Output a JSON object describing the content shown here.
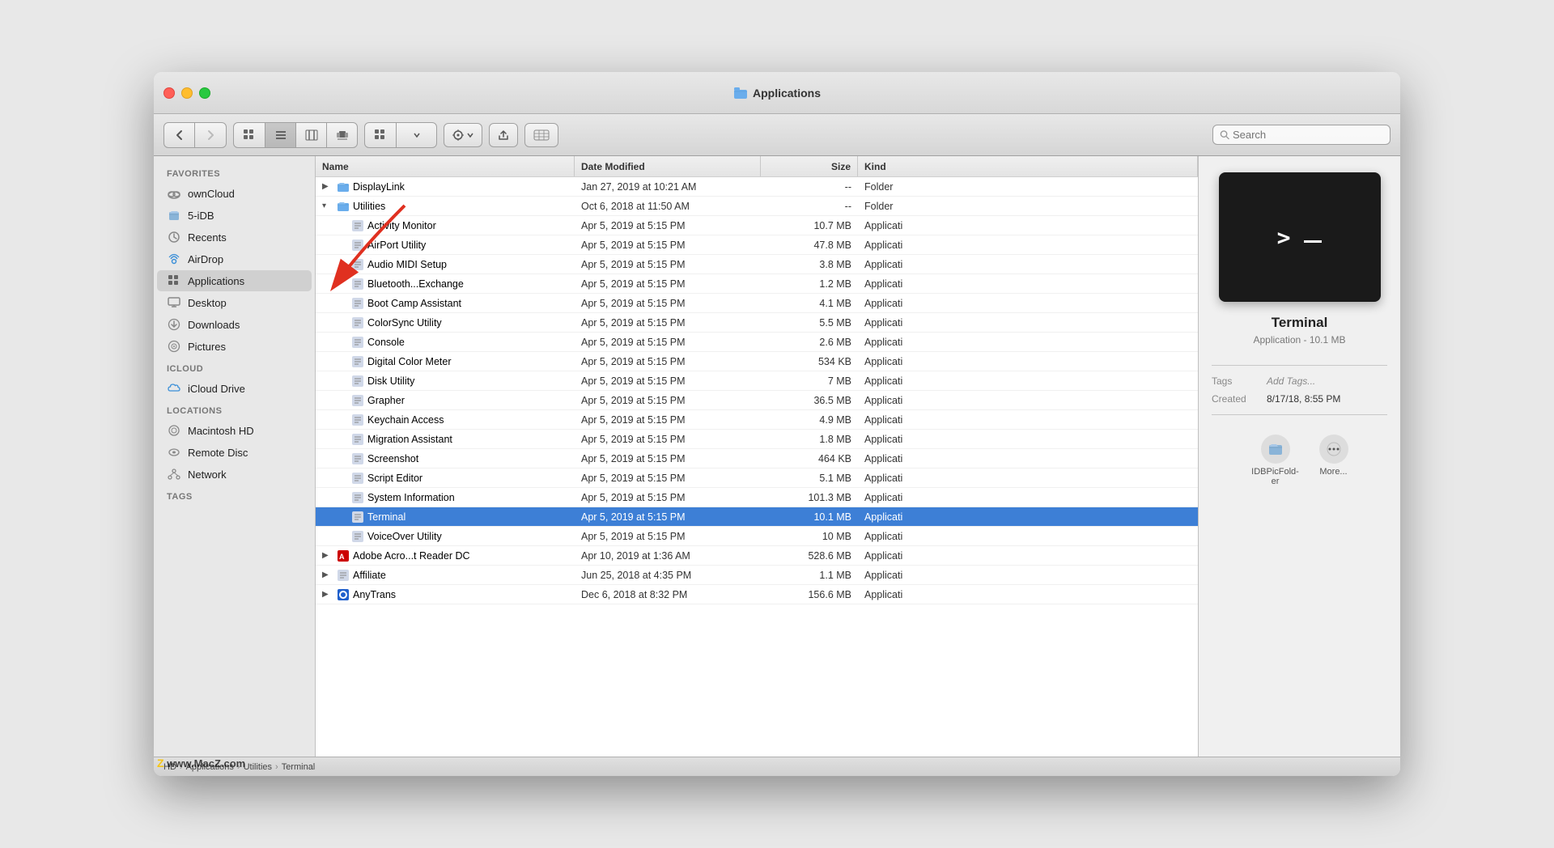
{
  "window": {
    "title": "Applications",
    "traffic_lights": [
      "close",
      "minimize",
      "maximize"
    ]
  },
  "toolbar": {
    "back_label": "‹",
    "forward_label": "›",
    "view_icon": "⊞",
    "view_list": "≡",
    "view_column": "⊟",
    "view_coverflow": "⊡",
    "view_group": "⊞",
    "action_label": "⚙",
    "share_label": "↑",
    "tag_label": "⬜",
    "search_placeholder": "Search"
  },
  "sidebar": {
    "favorites_label": "Favorites",
    "icloud_label": "iCloud",
    "locations_label": "Locations",
    "tags_label": "Tags",
    "items": [
      {
        "id": "owncloud",
        "label": "ownCloud",
        "icon": "cloud"
      },
      {
        "id": "5idb",
        "label": "5-iDB",
        "icon": "folder"
      },
      {
        "id": "recents",
        "label": "Recents",
        "icon": "clock"
      },
      {
        "id": "airdrop",
        "label": "AirDrop",
        "icon": "airdrop"
      },
      {
        "id": "applications",
        "label": "Applications",
        "icon": "grid",
        "active": true
      },
      {
        "id": "desktop",
        "label": "Desktop",
        "icon": "desktop"
      },
      {
        "id": "downloads",
        "label": "Downloads",
        "icon": "download"
      },
      {
        "id": "pictures",
        "label": "Pictures",
        "icon": "photo"
      },
      {
        "id": "icloud-drive",
        "label": "iCloud Drive",
        "icon": "icloud"
      },
      {
        "id": "macintosh-hd",
        "label": "Macintosh HD",
        "icon": "disk"
      },
      {
        "id": "remote-disc",
        "label": "Remote Disc",
        "icon": "disc"
      },
      {
        "id": "network",
        "label": "Network",
        "icon": "network"
      }
    ]
  },
  "columns": {
    "name": "Name",
    "date_modified": "Date Modified",
    "size": "Size",
    "kind": "Kind"
  },
  "files": [
    {
      "id": 1,
      "name": "DisplayLink",
      "date": "Jan 27, 2019 at 10:21 AM",
      "size": "--",
      "kind": "Folder",
      "indent": 0,
      "expanded": false,
      "type": "folder"
    },
    {
      "id": 2,
      "name": "Utilities",
      "date": "Oct 6, 2018 at 11:50 AM",
      "size": "--",
      "kind": "Folder",
      "indent": 0,
      "expanded": true,
      "type": "folder"
    },
    {
      "id": 3,
      "name": "Activity Monitor",
      "date": "Apr 5, 2019 at 5:15 PM",
      "size": "10.7 MB",
      "kind": "Applicati",
      "indent": 1,
      "type": "app"
    },
    {
      "id": 4,
      "name": "AirPort Utility",
      "date": "Apr 5, 2019 at 5:15 PM",
      "size": "47.8 MB",
      "kind": "Applicati",
      "indent": 1,
      "type": "app"
    },
    {
      "id": 5,
      "name": "Audio MIDI Setup",
      "date": "Apr 5, 2019 at 5:15 PM",
      "size": "3.8 MB",
      "kind": "Applicati",
      "indent": 1,
      "type": "app"
    },
    {
      "id": 6,
      "name": "Bluetooth...Exchange",
      "date": "Apr 5, 2019 at 5:15 PM",
      "size": "1.2 MB",
      "kind": "Applicati",
      "indent": 1,
      "type": "app"
    },
    {
      "id": 7,
      "name": "Boot Camp Assistant",
      "date": "Apr 5, 2019 at 5:15 PM",
      "size": "4.1 MB",
      "kind": "Applicati",
      "indent": 1,
      "type": "app"
    },
    {
      "id": 8,
      "name": "ColorSync Utility",
      "date": "Apr 5, 2019 at 5:15 PM",
      "size": "5.5 MB",
      "kind": "Applicati",
      "indent": 1,
      "type": "app"
    },
    {
      "id": 9,
      "name": "Console",
      "date": "Apr 5, 2019 at 5:15 PM",
      "size": "2.6 MB",
      "kind": "Applicati",
      "indent": 1,
      "type": "app"
    },
    {
      "id": 10,
      "name": "Digital Color Meter",
      "date": "Apr 5, 2019 at 5:15 PM",
      "size": "534 KB",
      "kind": "Applicati",
      "indent": 1,
      "type": "app"
    },
    {
      "id": 11,
      "name": "Disk Utility",
      "date": "Apr 5, 2019 at 5:15 PM",
      "size": "7 MB",
      "kind": "Applicati",
      "indent": 1,
      "type": "app"
    },
    {
      "id": 12,
      "name": "Grapher",
      "date": "Apr 5, 2019 at 5:15 PM",
      "size": "36.5 MB",
      "kind": "Applicati",
      "indent": 1,
      "type": "app"
    },
    {
      "id": 13,
      "name": "Keychain Access",
      "date": "Apr 5, 2019 at 5:15 PM",
      "size": "4.9 MB",
      "kind": "Applicati",
      "indent": 1,
      "type": "app"
    },
    {
      "id": 14,
      "name": "Migration Assistant",
      "date": "Apr 5, 2019 at 5:15 PM",
      "size": "1.8 MB",
      "kind": "Applicati",
      "indent": 1,
      "type": "app"
    },
    {
      "id": 15,
      "name": "Screenshot",
      "date": "Apr 5, 2019 at 5:15 PM",
      "size": "464 KB",
      "kind": "Applicati",
      "indent": 1,
      "type": "app"
    },
    {
      "id": 16,
      "name": "Script Editor",
      "date": "Apr 5, 2019 at 5:15 PM",
      "size": "5.1 MB",
      "kind": "Applicati",
      "indent": 1,
      "type": "app"
    },
    {
      "id": 17,
      "name": "System Information",
      "date": "Apr 5, 2019 at 5:15 PM",
      "size": "101.3 MB",
      "kind": "Applicati",
      "indent": 1,
      "type": "app"
    },
    {
      "id": 18,
      "name": "Terminal",
      "date": "Apr 5, 2019 at 5:15 PM",
      "size": "10.1 MB",
      "kind": "Applicati",
      "indent": 1,
      "type": "app",
      "selected": true
    },
    {
      "id": 19,
      "name": "VoiceOver Utility",
      "date": "Apr 5, 2019 at 5:15 PM",
      "size": "10 MB",
      "kind": "Applicati",
      "indent": 1,
      "type": "app"
    },
    {
      "id": 20,
      "name": "Adobe Acro...t Reader DC",
      "date": "Apr 10, 2019 at 1:36 AM",
      "size": "528.6 MB",
      "kind": "Applicati",
      "indent": 0,
      "type": "app-adobe"
    },
    {
      "id": 21,
      "name": "Affiliate",
      "date": "Jun 25, 2018 at 4:35 PM",
      "size": "1.1 MB",
      "kind": "Applicati",
      "indent": 0,
      "type": "app"
    },
    {
      "id": 22,
      "name": "AnyTrans",
      "date": "Dec 6, 2018 at 8:32 PM",
      "size": "156.6 MB",
      "kind": "Applicati",
      "indent": 0,
      "type": "app-blue"
    }
  ],
  "preview": {
    "app_name": "Terminal",
    "app_type": "Application - 10.1 MB",
    "tags_label": "Tags",
    "tags_action": "Add Tags...",
    "created_label": "Created",
    "created_value": "8/17/18, 8:55 PM",
    "action1_label": "IDBPicFold-\ner",
    "action2_label": "More...",
    "terminal_prompt": "> _"
  },
  "statusbar": {
    "path": [
      "HD",
      "Applications",
      "Utilities",
      "Terminal"
    ]
  },
  "watermark": "www.MacZ.com"
}
